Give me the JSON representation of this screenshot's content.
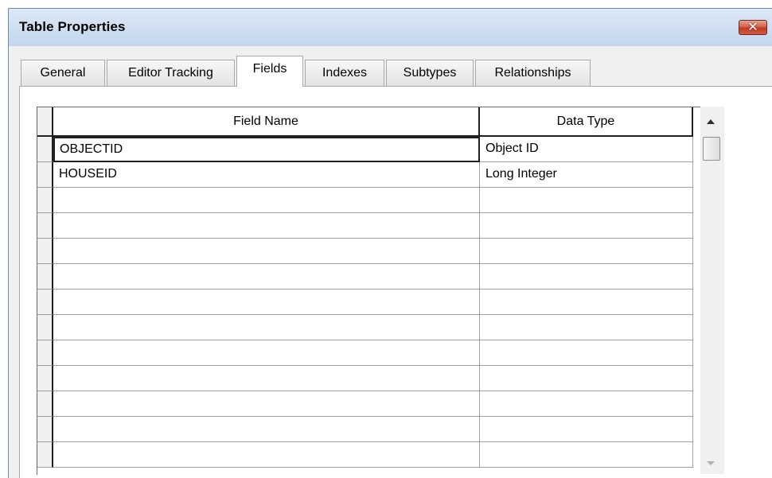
{
  "window": {
    "title": "Table Properties",
    "close_label": "✕"
  },
  "tabs": [
    {
      "label": "General",
      "active": false
    },
    {
      "label": "Editor Tracking",
      "active": false
    },
    {
      "label": "Fields",
      "active": true
    },
    {
      "label": "Indexes",
      "active": false
    },
    {
      "label": "Subtypes",
      "active": false
    },
    {
      "label": "Relationships",
      "active": false
    }
  ],
  "grid": {
    "columns": [
      "Field Name",
      "Data Type"
    ],
    "rows": [
      [
        "OBJECTID",
        "Object ID"
      ],
      [
        "HOUSEID",
        "Long Integer"
      ],
      [
        "",
        ""
      ],
      [
        "",
        ""
      ],
      [
        "",
        ""
      ],
      [
        "",
        ""
      ],
      [
        "",
        ""
      ],
      [
        "",
        ""
      ],
      [
        "",
        ""
      ],
      [
        "",
        ""
      ],
      [
        "",
        ""
      ],
      [
        "",
        ""
      ],
      [
        "",
        ""
      ]
    ]
  },
  "colors": {
    "titlebar": "#c4d6ec",
    "close_button": "#c13b25",
    "dialog_bg": "#f0f0f0"
  },
  "icons": {
    "close": "close-icon",
    "scroll_up": "scroll-up-arrow-icon",
    "scroll_down": "scroll-down-arrow-icon"
  }
}
